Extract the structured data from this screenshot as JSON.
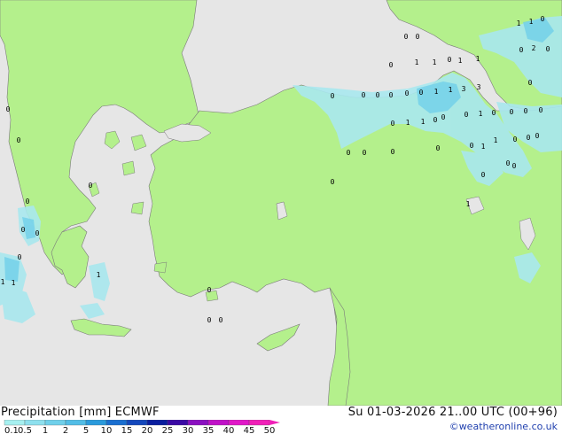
{
  "footer": {
    "title": "Precipitation [mm]  ECMWF",
    "datetime": "Su 01-03-2026 21..00 UTC (00+96)",
    "credit": "©weatheronline.co.uk"
  },
  "legend": {
    "ticks": [
      "0.1",
      "0.5",
      "1",
      "2",
      "5",
      "10",
      "15",
      "20",
      "25",
      "30",
      "35",
      "40",
      "45",
      "50"
    ],
    "colors": [
      "#a6f0f0",
      "#8ee0ee",
      "#70d0ea",
      "#52bde6",
      "#2a9adc",
      "#1a6fd0",
      "#1448bc",
      "#0a1e9e",
      "#3a0aa4",
      "#8a10c0",
      "#c012c8",
      "#e018c8",
      "#f020b8"
    ]
  },
  "map": {
    "land_color": "#b4f08c",
    "sea_color": "#e6e6e6",
    "precip_color": "#a8e8ee",
    "value_labels": [
      "0",
      "0",
      "0",
      "1",
      "1",
      "0",
      "1",
      "1",
      "1",
      "1",
      "2",
      "0",
      "0",
      "0",
      "0",
      "0",
      "0",
      "0",
      "0",
      "0",
      "1",
      "1",
      "3",
      "3",
      "0",
      "0",
      "1",
      "1",
      "0",
      "0",
      "1",
      "0",
      "0",
      "0",
      "0",
      "0",
      "0",
      "0",
      "0",
      "0",
      "1",
      "0",
      "0",
      "0",
      "1",
      "0",
      "0",
      "0",
      "0",
      "0",
      "0",
      "0",
      "0",
      "0",
      "0",
      "1",
      "1",
      "1",
      "0",
      "0",
      "0",
      "0",
      "0",
      "1"
    ]
  }
}
